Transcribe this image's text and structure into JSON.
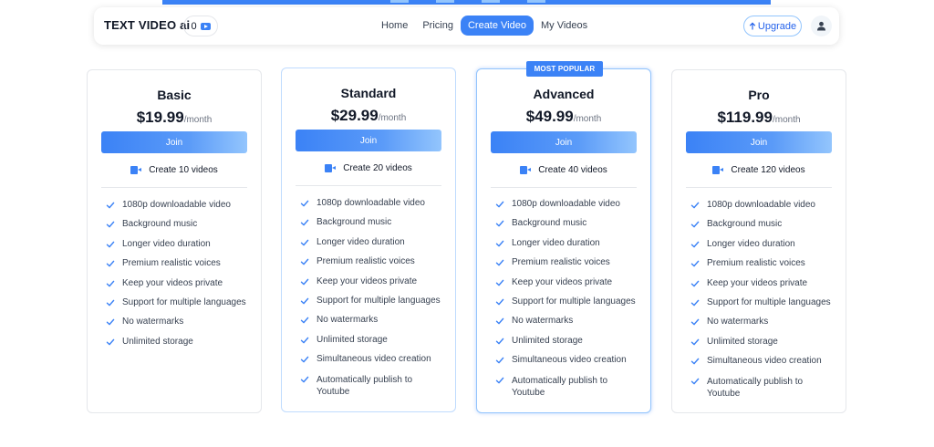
{
  "navbar": {
    "brand": "TEXT VIDEO ai",
    "credits": "0",
    "links": [
      {
        "label": "Home",
        "active": false
      },
      {
        "label": "Pricing",
        "active": false
      },
      {
        "label": "Create Video",
        "active": true
      },
      {
        "label": "My Videos",
        "active": false
      }
    ],
    "upgrade_label": "Upgrade",
    "upgrade_icon": "arrow-up-icon",
    "avatar_icon": "user-icon"
  },
  "colors": {
    "accent": "#3b82f6",
    "check": "#3b82f6",
    "text": "#1f2430"
  },
  "plans": [
    {
      "name": "Basic",
      "price": "$19.99",
      "period": "/month",
      "join_label": "Join",
      "videos_label": "Create 10 videos",
      "badge": "",
      "features": [
        "1080p downloadable video",
        "Background music",
        "Longer video duration",
        "Premium realistic voices",
        "Keep your videos private",
        "Support for multiple languages",
        "No watermarks",
        "Unlimited storage"
      ]
    },
    {
      "name": "Standard",
      "price": "$29.99",
      "period": "/month",
      "join_label": "Join",
      "videos_label": "Create 20 videos",
      "badge": "",
      "features": [
        "1080p downloadable video",
        "Background music",
        "Longer video duration",
        "Premium realistic voices",
        "Keep your videos private",
        "Support for multiple languages",
        "No watermarks",
        "Unlimited storage",
        "Simultaneous video creation",
        "Automatically publish to Youtube"
      ]
    },
    {
      "name": "Advanced",
      "price": "$49.99",
      "period": "/month",
      "join_label": "Join",
      "videos_label": "Create 40 videos",
      "badge": "MOST POPULAR",
      "features": [
        "1080p downloadable video",
        "Background music",
        "Longer video duration",
        "Premium realistic voices",
        "Keep your videos private",
        "Support for multiple languages",
        "No watermarks",
        "Unlimited storage",
        "Simultaneous video creation",
        "Automatically publish to Youtube"
      ]
    },
    {
      "name": "Pro",
      "price": "$119.99",
      "period": "/month",
      "join_label": "Join",
      "videos_label": "Create 120 videos",
      "badge": "",
      "features": [
        "1080p downloadable video",
        "Background music",
        "Longer video duration",
        "Premium realistic voices",
        "Keep your videos private",
        "Support for multiple languages",
        "No watermarks",
        "Unlimited storage",
        "Simultaneous video creation",
        "Automatically publish to Youtube"
      ]
    }
  ]
}
